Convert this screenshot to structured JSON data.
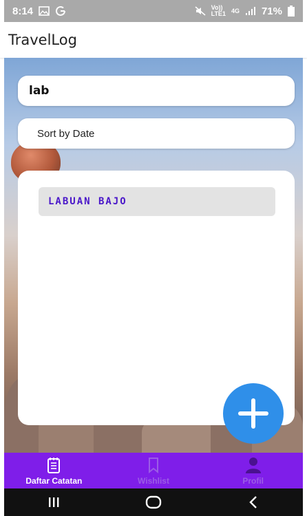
{
  "status_bar": {
    "time": "8:14",
    "left_icons": [
      "gallery-icon",
      "google-icon"
    ],
    "carrier_top": "Vo))",
    "carrier_bottom": "LTE1",
    "network": "4G",
    "battery": "71%",
    "background_color": "#a9a9a9"
  },
  "app_bar": {
    "title": "TravelLog"
  },
  "search": {
    "value": "lab"
  },
  "sort": {
    "label": "Sort by Date"
  },
  "list": {
    "items": [
      {
        "title": "LABUAN BAJO"
      }
    ]
  },
  "fab": {
    "icon": "plus-icon",
    "color": "#2f8fe9"
  },
  "bottom_nav": {
    "background_color": "#7f1ee9",
    "items": [
      {
        "label": "Daftar Catatan",
        "icon": "notes-icon",
        "active": true
      },
      {
        "label": "Wishlist",
        "icon": "bookmark-icon",
        "active": false
      },
      {
        "label": "Profil",
        "icon": "person-icon",
        "active": false
      }
    ]
  },
  "system_nav": {
    "buttons": [
      "recents-icon",
      "home-icon",
      "back-icon"
    ]
  }
}
